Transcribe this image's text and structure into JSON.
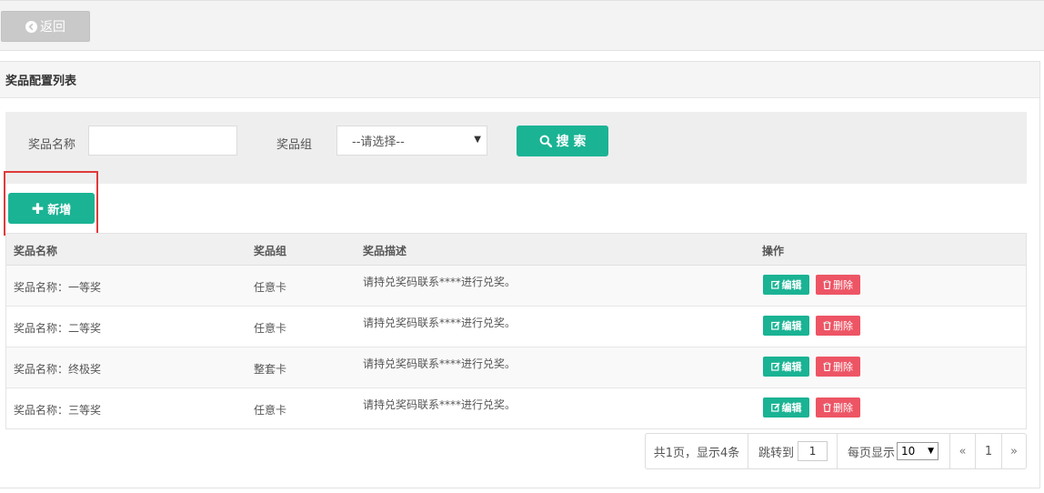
{
  "topbar": {
    "back_label": "返回"
  },
  "panel": {
    "title": "奖品配置列表"
  },
  "search": {
    "name_label": "奖品名称",
    "name_value": "",
    "group_label": "奖品组",
    "group_selected": "--请选择--",
    "search_label": "搜 索"
  },
  "add_label": "新增",
  "table": {
    "headers": [
      "奖品名称",
      "奖品组",
      "奖品描述",
      "操作"
    ],
    "edit_label": "编辑",
    "delete_label": "删除",
    "rows": [
      {
        "name": "奖品名称：一等奖",
        "group": "任意卡",
        "desc": "请持兑奖码联系****进行兑奖。"
      },
      {
        "name": "奖品名称：二等奖",
        "group": "任意卡",
        "desc": "请持兑奖码联系****进行兑奖。"
      },
      {
        "name": "奖品名称：终极奖",
        "group": "整套卡",
        "desc": "请持兑奖码联系****进行兑奖。"
      },
      {
        "name": "奖品名称：三等奖",
        "group": "任意卡",
        "desc": "请持兑奖码联系****进行兑奖。"
      }
    ]
  },
  "pager": {
    "info": "共1页，显示4条",
    "jump_label": "跳转到",
    "jump_value": "1",
    "size_label": "每页显示",
    "size_value": "10",
    "prev": "«",
    "current": "1",
    "next": "»"
  },
  "colors": {
    "primary": "#1ab394",
    "danger": "#ed5565",
    "highlight": "#e03a3a"
  }
}
